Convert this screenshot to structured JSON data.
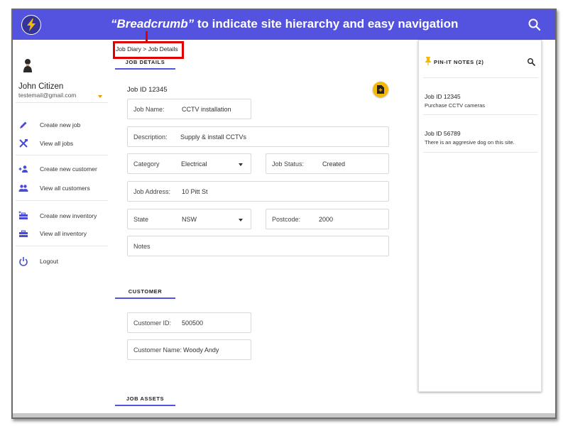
{
  "annotation": {
    "title_em": "“Breadcrumb”",
    "title_rest": " to indicate site hierarchy and easy navigation"
  },
  "header": {
    "breadcrumb": "Job Diary > Job Details"
  },
  "user": {
    "name": "John Citizen",
    "email": "testemail@gmail.com"
  },
  "sidebar": {
    "items": [
      {
        "label": "Create new job",
        "icon": "pencil-icon"
      },
      {
        "label": "View all jobs",
        "icon": "tools-icon"
      },
      {
        "label": "Create new customer",
        "icon": "add-group-icon"
      },
      {
        "label": "View all customers",
        "icon": "group-icon"
      },
      {
        "label": "Create new inventory",
        "icon": "toolbox-add-icon"
      },
      {
        "label": "View all inventory",
        "icon": "toolbox-icon"
      },
      {
        "label": "Logout",
        "icon": "power-icon"
      }
    ]
  },
  "job_details": {
    "section_title": "JOB DETAILS",
    "job_id_label": "Job ID  12345",
    "job_name_label": "Job Name:",
    "job_name": "CCTV installation",
    "description_label": "Description:",
    "description": "Supply & install CCTVs",
    "category_label": "Category",
    "category": "Electrical",
    "status_label": "Job Status:",
    "status": "Created",
    "address_label": "Job Address:",
    "address": "10 Pitt St",
    "state_label": "State",
    "state": "NSW",
    "postcode_label": "Postcode:",
    "postcode": "2000",
    "notes_label": "Notes"
  },
  "customer": {
    "section_title": "CUSTOMER",
    "id_label": "Customer ID:",
    "id": "500500",
    "name_label": "Customer Name:",
    "name": "Woody Andy"
  },
  "job_assets": {
    "section_title": "JOB ASSETS"
  },
  "pin_notes": {
    "title": "PIN-IT NOTES (2)",
    "notes": [
      {
        "id": "Job ID 12345",
        "text": "Purchase CCTV cameras"
      },
      {
        "id": "Job ID 56789",
        "text": "There is an aggresive dog on this site."
      }
    ]
  },
  "colors": {
    "accent": "#5353e0",
    "highlight": "#e00000",
    "action": "#f2b90a",
    "user_caret": "#e89b00"
  }
}
